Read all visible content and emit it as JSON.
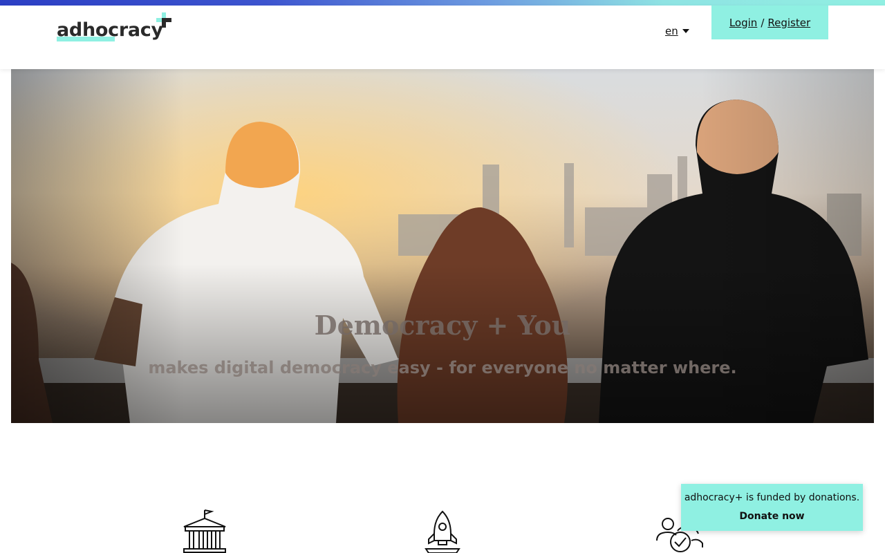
{
  "header": {
    "logo_text": "adhocracy",
    "language": "en",
    "login_label": "Login",
    "separator": "/",
    "register_label": "Register"
  },
  "hero": {
    "title": "Democracy + You",
    "subtitle": "makes digital democracy easy - for everyone no matter where."
  },
  "features": {
    "icons": [
      "institution-icon",
      "rocket-icon",
      "community-check-icon"
    ]
  },
  "donation_banner": {
    "text": "adhocracy+ is funded by donations.",
    "link_label": "Donate now"
  },
  "colors": {
    "accent": "#8ff0e2",
    "stripe_start": "#2c3fc4",
    "stripe_end": "#90efe2"
  }
}
